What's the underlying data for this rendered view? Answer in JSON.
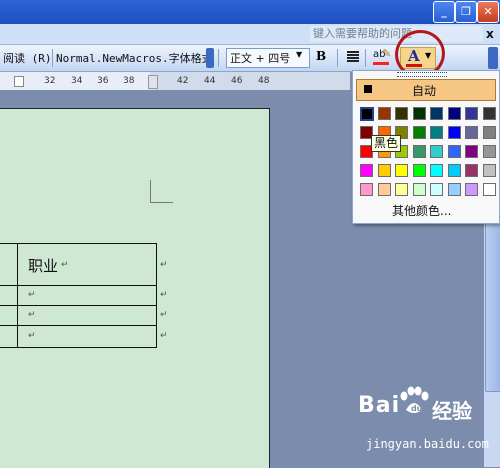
{
  "window": {
    "minimize_glyph": "_",
    "restore_glyph": "❐",
    "close_glyph": "✕"
  },
  "menubar": {
    "help_placeholder": "键入需要帮助的问题",
    "close_glyph": "x"
  },
  "toolbar": {
    "reading_label": "阅读 (R)",
    "macro_label": "Normal.NewMacros.字体格式",
    "style_value": "正文 + 四号",
    "bold_label": "B",
    "font_color_letter": "A",
    "highlight_letters": "ab"
  },
  "ruler": {
    "ticks": [
      "32",
      "34",
      "36",
      "38",
      "42",
      "44",
      "46",
      "48"
    ]
  },
  "document": {
    "table_header_cell": "职业",
    "paragraph_mark": "↵"
  },
  "palette": {
    "automatic_label": "自动",
    "tooltip": "黑色",
    "more_colors_label": "其他颜色...",
    "colors": [
      [
        "#000000",
        "#993300",
        "#333300",
        "#003300",
        "#003366",
        "#000080",
        "#333399",
        "#333333"
      ],
      [
        "#800000",
        "#FF6600",
        "#808000",
        "#008000",
        "#008080",
        "#0000FF",
        "#666699",
        "#808080"
      ],
      [
        "#FF0000",
        "#FF9900",
        "#99CC00",
        "#339966",
        "#33CCCC",
        "#3366FF",
        "#800080",
        "#969696"
      ],
      [
        "#FF00FF",
        "#FFCC00",
        "#FFFF00",
        "#00FF00",
        "#00FFFF",
        "#00CCFF",
        "#993366",
        "#C0C0C0"
      ],
      [
        "#FF99CC",
        "#FFCC99",
        "#FFFF99",
        "#CCFFCC",
        "#CCFFFF",
        "#99CCFF",
        "#CC99FF",
        "#FFFFFF"
      ]
    ]
  },
  "watermark": {
    "brand": "Bai",
    "brand_suffix": "经验",
    "url": "jingyan.baidu.com"
  }
}
